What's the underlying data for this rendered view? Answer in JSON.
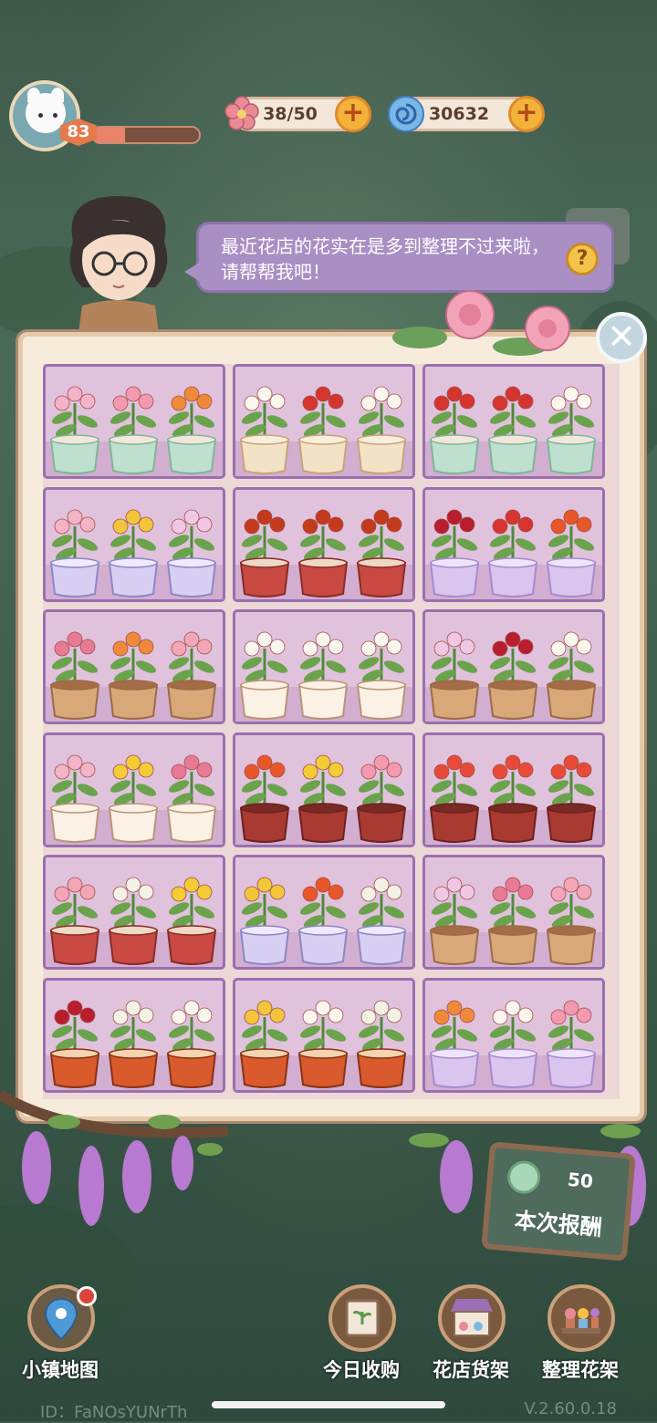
{
  "player": {
    "level": "83",
    "xp_fraction": 0.3
  },
  "resources": {
    "flowers": {
      "value": "38/50",
      "icon": "pink-flower-icon"
    },
    "swirl": {
      "value": "30632",
      "icon": "blue-swirl-icon"
    }
  },
  "dialog": {
    "message": "最近花店的花实在是多到整理不过来啦，请帮帮我吧！",
    "help": "?"
  },
  "board": {
    "rows": 6,
    "cols": 3,
    "cells": [
      {
        "pot": "mint-dot",
        "flowers": [
          "pink-azalea",
          "pink-lotus",
          "orange-geranium"
        ]
      },
      {
        "pot": "bow-cream",
        "flowers": [
          "white-lily",
          "red-geranium",
          "white-lily"
        ]
      },
      {
        "pot": "mint-dot",
        "flowers": [
          "red-geranium",
          "red-geranium",
          "white-lily"
        ]
      },
      {
        "pot": "glass",
        "flowers": [
          "pink-azalea",
          "yellow-hyacinth",
          "pink-orchid"
        ]
      },
      {
        "pot": "red-dome",
        "flowers": [
          "maple-bonsai",
          "maple-bonsai",
          "maple-bonsai"
        ]
      },
      {
        "pot": "lavender-glass",
        "flowers": [
          "red-chrysanthemum",
          "red-geranium",
          "orange-poinsettia"
        ]
      },
      {
        "pot": "terracotta",
        "flowers": [
          "pink-lily",
          "orange-geranium",
          "pink-geranium"
        ]
      },
      {
        "pot": "cat-cup",
        "flowers": [
          "white-hyacinth",
          "white-hyacinth",
          "white-hyacinth"
        ]
      },
      {
        "pot": "terracotta",
        "flowers": [
          "pink-orchid",
          "red-chrysanthemum",
          "white-lily"
        ]
      },
      {
        "pot": "cat-cup",
        "flowers": [
          "pink-azalea",
          "yellow-orchid",
          "pink-lily"
        ]
      },
      {
        "pot": "red-clay",
        "flowers": [
          "orange-poinsettia",
          "yellow-orchid",
          "pink-lotus"
        ]
      },
      {
        "pot": "red-clay",
        "flowers": [
          "red-tulip",
          "red-tulip",
          "red-tulip"
        ]
      },
      {
        "pot": "red-dome",
        "flowers": [
          "pink-geranium",
          "white-clover",
          "yellow-orchid"
        ]
      },
      {
        "pot": "glass",
        "flowers": [
          "yellow-hyacinth",
          "orange-poinsettia",
          "white-clover"
        ]
      },
      {
        "pot": "terracotta",
        "flowers": [
          "pink-orchid",
          "pink-lily",
          "pink-geranium"
        ]
      },
      {
        "pot": "goldfish",
        "flowers": [
          "red-chrysanthemum",
          "white-clover",
          "white-lily"
        ]
      },
      {
        "pot": "goldfish",
        "flowers": [
          "yellow-hyacinth",
          "white-lily",
          "white-clover"
        ]
      },
      {
        "pot": "lavender-glass",
        "flowers": [
          "orange-geranium",
          "white-lily",
          "pink-lotus"
        ]
      }
    ]
  },
  "reward": {
    "amount": "50",
    "label": "本次报酬",
    "icon": "clover-coin-icon"
  },
  "nav": [
    {
      "label": "小镇地图",
      "icon": "map-pin-icon"
    },
    {
      "label": "今日收购",
      "icon": "plant-frame-icon"
    },
    {
      "label": "花店货架",
      "icon": "market-stall-icon"
    },
    {
      "label": "整理花架",
      "icon": "flower-shelf-icon"
    }
  ],
  "footer": {
    "id": "ID：FaNOsYUNrTh",
    "version": "V.2.60.0.18"
  },
  "colors": {
    "panel": "#f7ecdc",
    "cell": "#e1c2dd",
    "cell_border": "#9a6fb0",
    "bubble": "#a98fc4",
    "accent": "#f3b23a"
  }
}
